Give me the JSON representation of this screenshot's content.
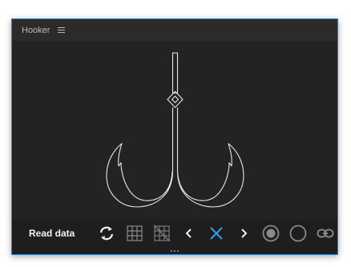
{
  "panel": {
    "title": "Hooker",
    "menu_icon": "hamburger-menu-icon"
  },
  "toolbar": {
    "read_label": "Read data",
    "icons": [
      "refresh-icon",
      "grid-icon",
      "grid-disabled-icon",
      "chevron-left-icon",
      "close-icon",
      "chevron-right-icon",
      "radio-filled-icon",
      "radio-empty-icon",
      "link-icon"
    ]
  },
  "colors": {
    "panel_bg": "#232323",
    "accent": "#3b82c4",
    "close_x": "#3d9be9",
    "icon": "#c8c8c8",
    "icon_dim": "#8a8a8a",
    "stroke": "#e8e8e8"
  }
}
